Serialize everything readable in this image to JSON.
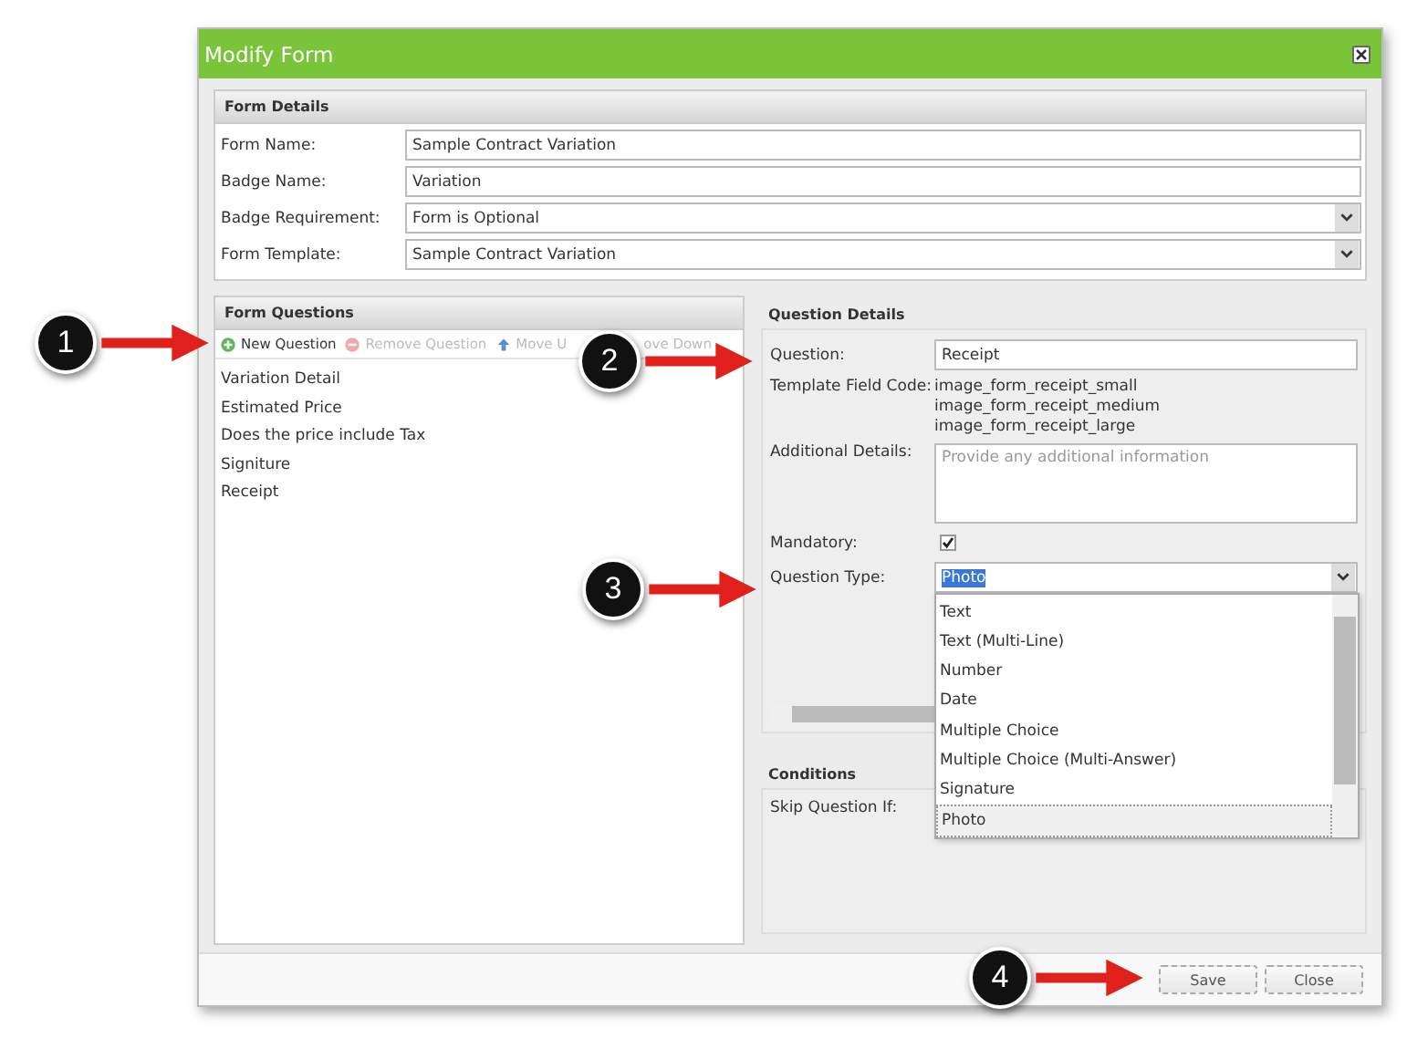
{
  "window": {
    "title": "Modify Form"
  },
  "form_details": {
    "title": "Form Details",
    "fields": [
      {
        "label": "Form Name:",
        "kind": "text",
        "value": "Sample Contract Variation"
      },
      {
        "label": "Badge Name:",
        "kind": "text",
        "value": "Variation"
      },
      {
        "label": "Badge Requirement:",
        "kind": "select",
        "value": "Form is Optional"
      },
      {
        "label": "Form Template:",
        "kind": "select",
        "value": "Sample Contract Variation"
      }
    ]
  },
  "form_questions": {
    "title": "Form Questions",
    "toolbar": [
      {
        "label": "New Question",
        "kind": "add",
        "disabled": false
      },
      {
        "label": "Remove Question",
        "kind": "remove",
        "disabled": true
      },
      {
        "label": "Move U",
        "kind": "up",
        "disabled": true
      },
      {
        "label": "ove Down",
        "kind": "down",
        "disabled": true
      }
    ],
    "items": [
      "Variation Detail",
      "Estimated Price",
      "Does the price include Tax",
      "Signiture",
      "Receipt"
    ]
  },
  "question_details": {
    "title": "Question Details",
    "question_label": "Question:",
    "question_value": "Receipt",
    "template_label": "Template Field Code:",
    "template_codes": [
      "image_form_receipt_small",
      "image_form_receipt_medium",
      "image_form_receipt_large"
    ],
    "additional_label": "Additional Details:",
    "additional_placeholder": "Provide any additional information",
    "mandatory_label": "Mandatory:",
    "mandatory_checked": true,
    "type_label": "Question Type:",
    "type_value": "Photo",
    "type_options": [
      {
        "label": "Text",
        "selected": false
      },
      {
        "label": "Text (Multi-Line)",
        "selected": false
      },
      {
        "label": "Number",
        "selected": false
      },
      {
        "label": "Date",
        "selected": false
      },
      {
        "label": "Multiple Choice",
        "selected": false
      },
      {
        "label": "Multiple Choice (Multi-Answer)",
        "selected": false
      },
      {
        "label": "Signature",
        "selected": false
      },
      {
        "label": "Photo",
        "selected": true
      }
    ]
  },
  "conditions": {
    "title": "Conditions",
    "skip_label": "Skip Question If:"
  },
  "buttons": [
    "Save",
    "Close"
  ],
  "callouts": [
    "1",
    "2",
    "3",
    "4"
  ]
}
